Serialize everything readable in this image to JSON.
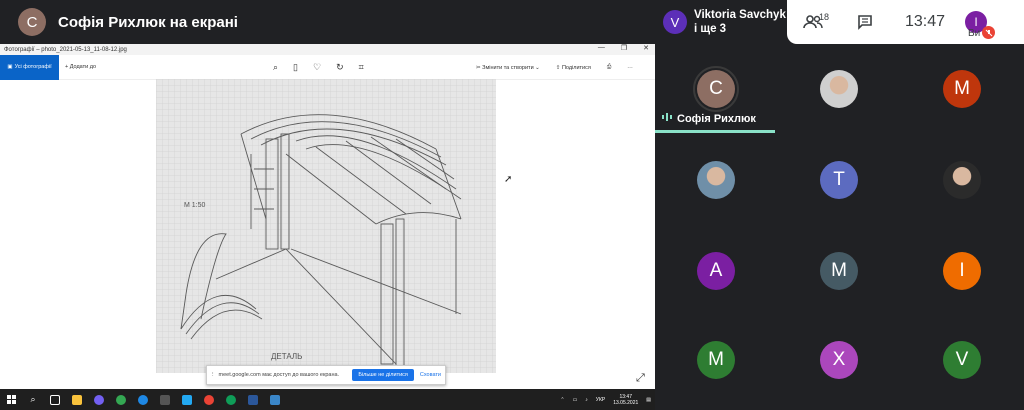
{
  "presenter": {
    "avatar_letter": "С",
    "title": "Софія Рихлюк на екрані"
  },
  "host": {
    "avatar_letter": "V",
    "name": "Viktoria Savchyk",
    "others": "і ще 3"
  },
  "topbar": {
    "people_count": "18",
    "time": "13:47",
    "self_letter": "I",
    "self_label": "Ви"
  },
  "photos_app": {
    "window_title": "Фотографії – photo_2021-05-13_11-08-12.jpg",
    "all_photos": "Усі фотографії",
    "add_to": "Додати до",
    "edit_create": "Змінити та створити",
    "share": "Поділитися",
    "more": "···"
  },
  "drawing_labels": {
    "scale": "М 1:50",
    "detail": "ДЕТАЛЬ"
  },
  "share_banner": {
    "text": "meet.google.com має доступ до вашого екрана.",
    "stop": "Більше не ділитися",
    "hide": "Сховати"
  },
  "taskbar": {
    "lang": "УКР",
    "time": "13:47",
    "date": "13.05.2021"
  },
  "participants": [
    {
      "letter": "С",
      "color": "#8d6e63",
      "name": "Софія Рихлюк",
      "speaking": true
    },
    {
      "photo": true,
      "photo_tone": "#cfcfcf"
    },
    {
      "letter": "M",
      "color": "#bf360c"
    },
    {
      "photo": true,
      "photo_tone": "#6f8fa8"
    },
    {
      "letter": "T",
      "color": "#5c6bc0"
    },
    {
      "photo": true,
      "photo_tone": "#2b2b2b"
    },
    {
      "letter": "A",
      "color": "#7b1fa2"
    },
    {
      "letter": "M",
      "color": "#455a64"
    },
    {
      "letter": "I",
      "color": "#ef6c00"
    },
    {
      "letter": "M",
      "color": "#2e7d32"
    },
    {
      "letter": "X",
      "color": "#ab47bc"
    },
    {
      "letter": "V",
      "color": "#2e7d32"
    }
  ]
}
